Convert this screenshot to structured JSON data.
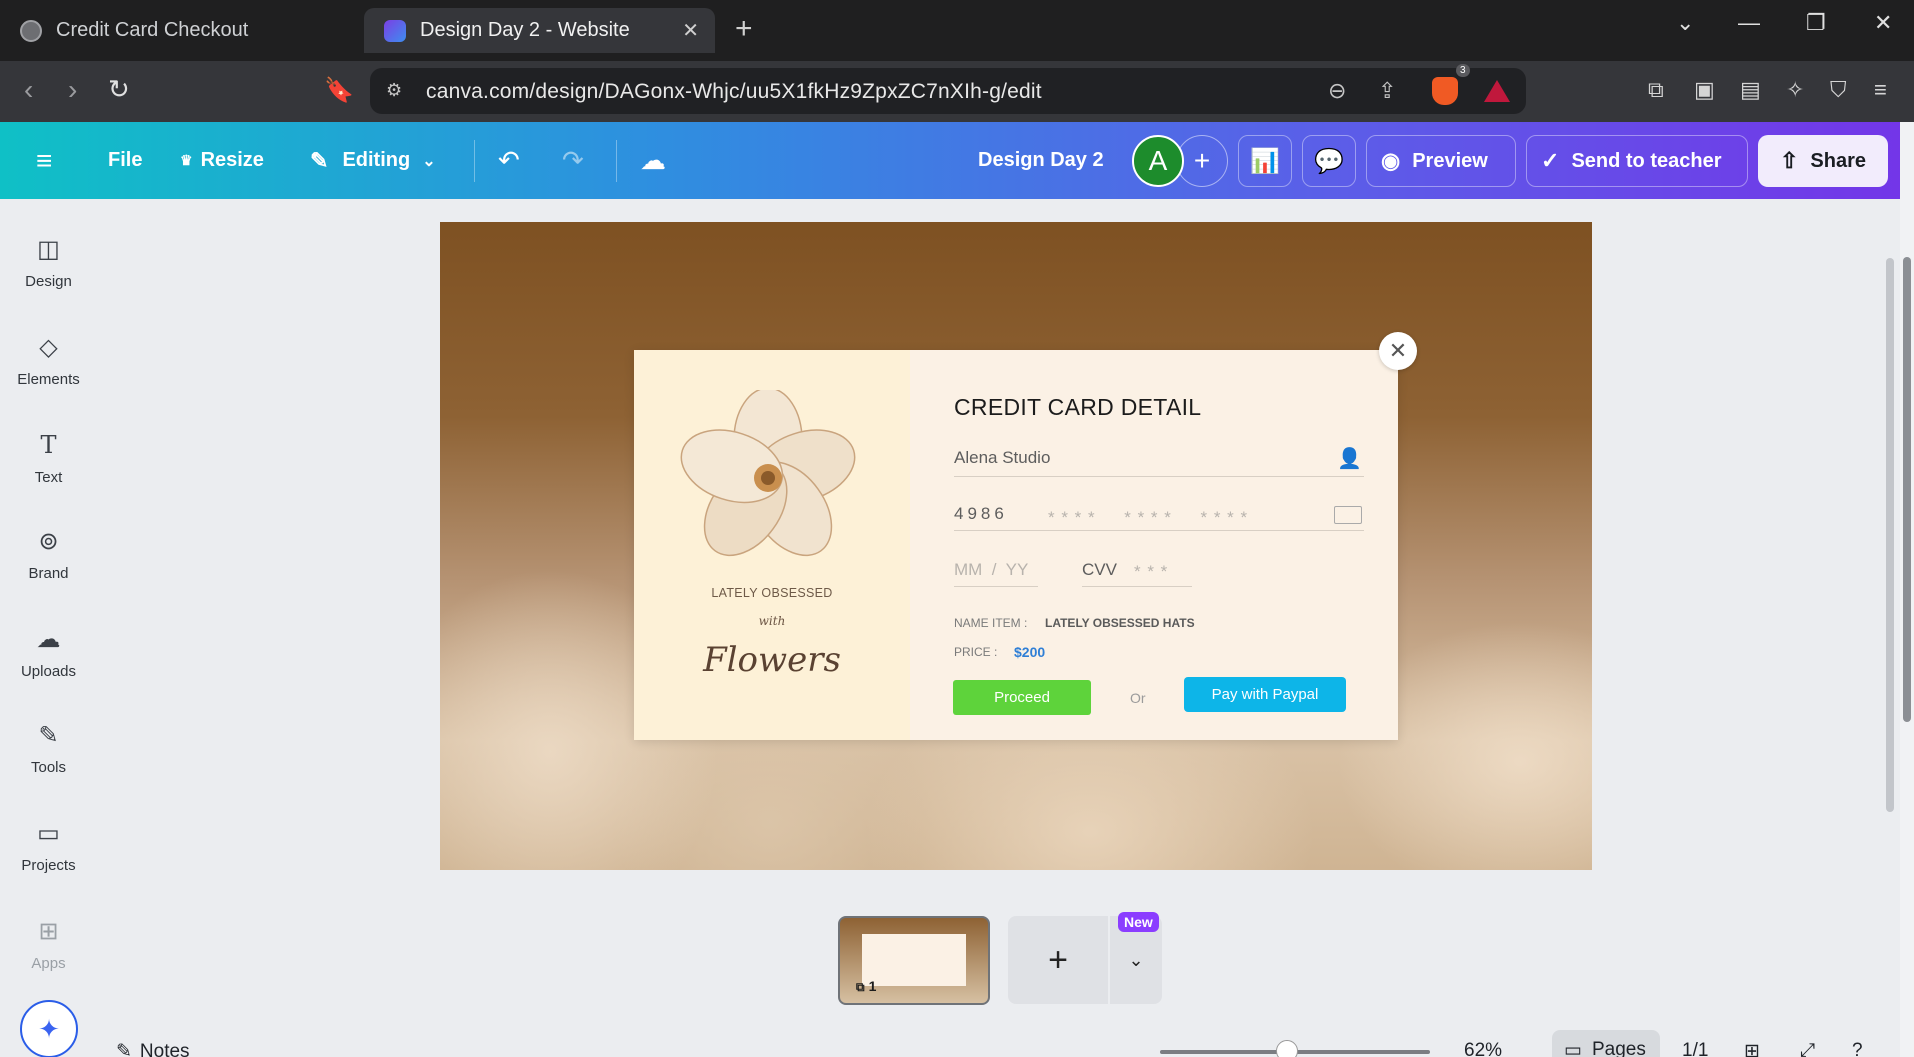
{
  "browser": {
    "tabs": [
      {
        "title": "Credit Card Checkout",
        "active": false
      },
      {
        "title": "Design Day 2 - Website",
        "active": true
      }
    ],
    "url": "canva.com/design/DAGonx-Whjc/uu5X1fkHz9ZpxZC7nXIh-g/edit",
    "brave_badge_count": "3"
  },
  "toolbar": {
    "file_label": "File",
    "resize_label": "Resize",
    "editing_label": "Editing",
    "doc_title": "Design Day 2",
    "avatar_letter": "A",
    "preview_label": "Preview",
    "send_label": "Send to teacher",
    "share_label": "Share"
  },
  "sidebar": {
    "items": [
      {
        "label": "Design",
        "icon": "design-icon"
      },
      {
        "label": "Elements",
        "icon": "elements-icon"
      },
      {
        "label": "Text",
        "icon": "text-icon"
      },
      {
        "label": "Brand",
        "icon": "brand-icon"
      },
      {
        "label": "Uploads",
        "icon": "uploads-icon"
      },
      {
        "label": "Tools",
        "icon": "tools-icon"
      },
      {
        "label": "Projects",
        "icon": "projects-icon"
      },
      {
        "label": "Apps",
        "icon": "apps-icon"
      }
    ]
  },
  "design": {
    "card_title": "CREDIT CARD DETAIL",
    "name_value": "Alena Studio",
    "card_number_prefix": "4986",
    "card_number_mask": "* * * *     * * * *     * * * *",
    "expiry_placeholder": "MM  /  YY",
    "cvv_label": "CVV",
    "cvv_mask": "* * *",
    "name_item_label": "NAME ITEM :",
    "name_item_value": "LATELY OBSESSED HATS",
    "price_label": "PRICE :",
    "price_value": "$200",
    "proceed_label": "Proceed",
    "or_label": "Or",
    "paypal_label": "Pay with Paypal",
    "left_panel_caption": "LATELY OBSESSED",
    "left_panel_with": "with",
    "left_panel_script": "Flowers"
  },
  "pages": {
    "thumb_number": "1",
    "new_badge": "New"
  },
  "footer": {
    "notes_label": "Notes",
    "zoom": "62%",
    "pages_label": "Pages",
    "page_count": "1/1"
  },
  "colors": {
    "proceed": "#5ed33b",
    "paypal": "#0db5e8",
    "price": "#2f7fd6",
    "new_badge": "#8b3dff"
  }
}
